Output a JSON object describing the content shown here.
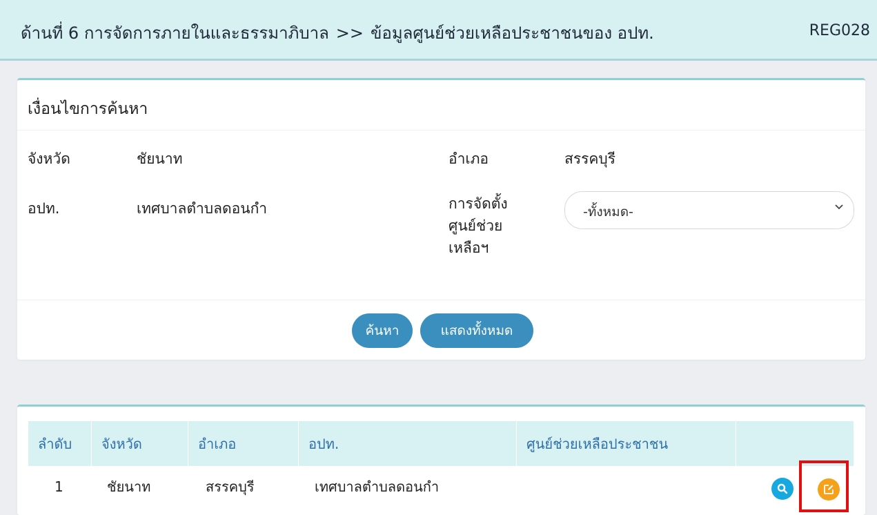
{
  "header": {
    "section": "ด้านที่ 6 การจัดการภายในและธรรมาภิบาล",
    "separator": ">>",
    "page": "ข้อมูลศูนย์ช่วยเหลือประชาชนของ อปท.",
    "code": "REG028"
  },
  "search": {
    "title": "เงื่อนไขการค้นหา",
    "province_label": "จังหวัด",
    "province_value": "ชัยนาท",
    "district_label": "อำเภอ",
    "district_value": "สรรคบุรี",
    "lao_label": "อปท.",
    "lao_value": "เทศบาลตำบลดอนกำ",
    "center_label_line1": "การจัดตั้ง",
    "center_label_line2": "ศูนย์ช่วย",
    "center_label_line3": "เหลือฯ",
    "center_select_value": "-ทั้งหมด-",
    "search_button": "ค้นหา",
    "show_all_button": "แสดงทั้งหมด"
  },
  "table": {
    "headers": [
      "ลำดับ",
      "จังหวัด",
      "อำเภอ",
      "อปท.",
      "ศูนย์ช่วยเหลือประชาชน",
      ""
    ],
    "rows": [
      {
        "no": "1",
        "province": "ชัยนาท",
        "district": "สรรคบุรี",
        "lao": "เทศบาลตำบลดอนกำ",
        "center": ""
      }
    ]
  },
  "icons": {
    "view": "search-icon",
    "edit": "edit-icon"
  },
  "colors": {
    "header_bg": "#d7f0f1",
    "primary_button": "#3a8fbf",
    "view_button": "#17a8e0",
    "edit_button": "#f5a11c",
    "highlight": "#e01010"
  }
}
